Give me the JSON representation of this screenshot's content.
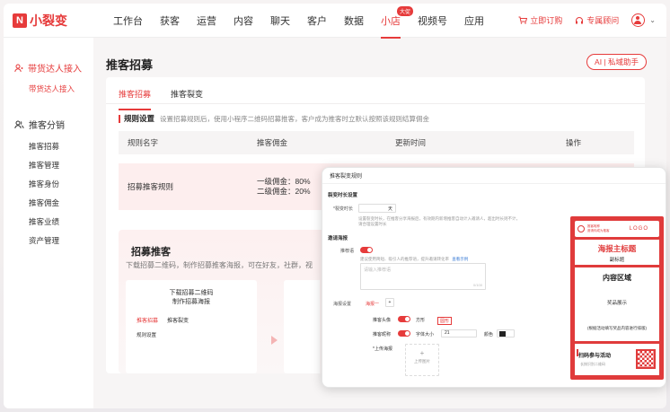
{
  "app": {
    "logo_text": "小裂变",
    "logo_mark": "N"
  },
  "nav": {
    "items": [
      "工作台",
      "获客",
      "运营",
      "内容",
      "聊天",
      "客户",
      "数据",
      "小店",
      "视频号",
      "应用"
    ],
    "active_index": 7,
    "badge": "大促",
    "order_link": "立即订购",
    "advisor_link": "专属顾问"
  },
  "sidebar": {
    "group1": "带货达人接入",
    "group1_sub": "带货达人接入",
    "group2": "推客分销",
    "group2_subs": [
      "推客招募",
      "推客管理",
      "推客身份",
      "推客佣金",
      "推客业绩",
      "资产管理"
    ]
  },
  "main": {
    "title": "推客招募",
    "ai_button": "AI | 私域助手",
    "tabs": [
      "推客招募",
      "推客裂变"
    ],
    "rule_title": "规则设置",
    "rule_desc": "设置招募规则后，使用小程序二维码招募推客，客户成为推客时立默认按照该规则结算佣金",
    "table": {
      "headers": [
        "规则名字",
        "推客佣金",
        "更新时间",
        "操作"
      ],
      "row": {
        "name": "招募推客规则",
        "commission_1": "一级佣金：80%",
        "commission_2": "二级佣金：20%"
      }
    },
    "promo": {
      "title": "招募推客",
      "desc": "下载招募二维码，制作招募推客海报，可在好友，社群，视",
      "mini_title_1": "下载招募二维码",
      "mini_title_2": "制作招募海报",
      "mini_tabs": [
        "推客招募",
        "推客裂变"
      ],
      "mini_rule": "规则设置"
    }
  },
  "overlay": {
    "header": "推客裂变规则",
    "section1": "裂变时长设置",
    "duration_label": "*裂变时长",
    "duration_unit": "天",
    "duration_help": "设置裂变时长，在推客分享海报后，有效期内新增推客自动计入邀请人，超出时长则不计，请合理设置时长",
    "section2": "邀请海报",
    "recommend_label": "推荐语",
    "recommend_placeholder": "请输入推荐语",
    "recommend_help": "建议使用简短、吸引人的推荐语，提升邀请转化率",
    "recommend_link": "查看示例",
    "counter": "0/100",
    "section3": "海报设置",
    "poster_tab": "海报一",
    "poster_add": "+",
    "avatar_label": "推客头像",
    "avatar_shape_1": "方形",
    "avatar_shape_2": "圆形",
    "nickname_label": "推客昵称",
    "font_size_label": "字体大小",
    "font_size_value": "21",
    "color_label": "颜色",
    "upload_label": "*上传海报",
    "upload_button": "上传图片",
    "poster": {
      "logo": "LOGO",
      "user_line_1": "推客昵称",
      "user_line_2": "邀请你成为推客",
      "main_title": "海报主标题",
      "sub_title": "副标题",
      "content_title": "内容区域",
      "content_sub": "奖品展示",
      "content_note": "(根据活动填写奖品内容进行排版)",
      "bottom_text": "扫码参与活动",
      "bottom_sub": "长按识别二维码"
    }
  }
}
